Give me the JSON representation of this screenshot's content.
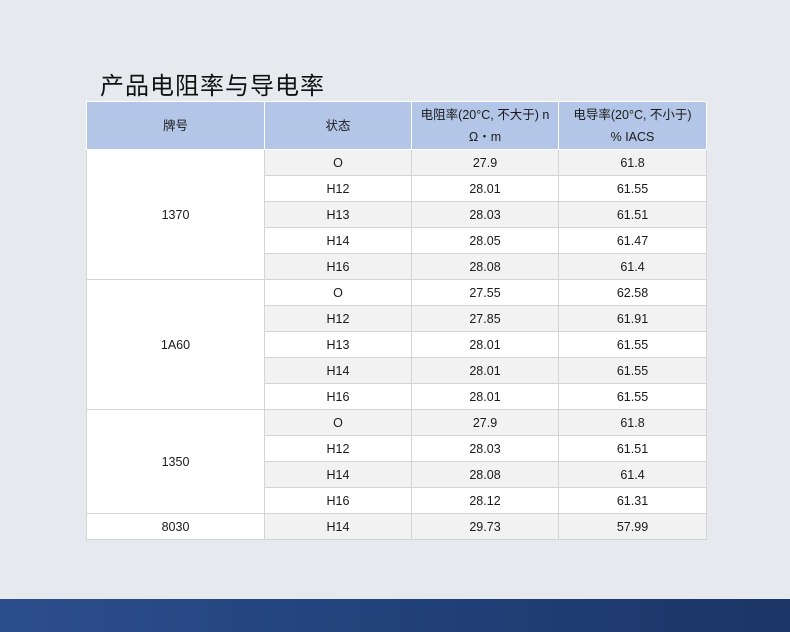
{
  "title": "产品电阻率与导电率",
  "table": {
    "headers": {
      "grade": "牌号",
      "state": "状态",
      "resistivity_line1": "电阻率(20°C, 不大于) n",
      "resistivity_line2": "Ω・m",
      "conductivity_line1": "电导率(20°C, 不小于)",
      "conductivity_line2": "% IACS"
    },
    "groups": [
      {
        "grade": "1370",
        "rows": [
          {
            "state": "O",
            "resistivity": "27.9",
            "conductivity": "61.8"
          },
          {
            "state": "H12",
            "resistivity": "28.01",
            "conductivity": "61.55"
          },
          {
            "state": "H13",
            "resistivity": "28.03",
            "conductivity": "61.51"
          },
          {
            "state": "H14",
            "resistivity": "28.05",
            "conductivity": "61.47"
          },
          {
            "state": "H16",
            "resistivity": "28.08",
            "conductivity": "61.4"
          }
        ]
      },
      {
        "grade": "1A60",
        "rows": [
          {
            "state": "O",
            "resistivity": "27.55",
            "conductivity": "62.58"
          },
          {
            "state": "H12",
            "resistivity": "27.85",
            "conductivity": "61.91"
          },
          {
            "state": "H13",
            "resistivity": "28.01",
            "conductivity": "61.55"
          },
          {
            "state": "H14",
            "resistivity": "28.01",
            "conductivity": "61.55"
          },
          {
            "state": "H16",
            "resistivity": "28.01",
            "conductivity": "61.55"
          }
        ]
      },
      {
        "grade": "1350",
        "rows": [
          {
            "state": "O",
            "resistivity": "27.9",
            "conductivity": "61.8"
          },
          {
            "state": "H12",
            "resistivity": "28.03",
            "conductivity": "61.51"
          },
          {
            "state": "H14",
            "resistivity": "28.08",
            "conductivity": "61.4"
          },
          {
            "state": "H16",
            "resistivity": "28.12",
            "conductivity": "61.31"
          }
        ]
      },
      {
        "grade": "8030",
        "rows": [
          {
            "state": "H14",
            "resistivity": "29.73",
            "conductivity": "57.99"
          }
        ]
      }
    ]
  },
  "colors": {
    "header_bg": "#b4c6e7",
    "stripe": "#f2f2f2",
    "footer": "#23447e"
  }
}
